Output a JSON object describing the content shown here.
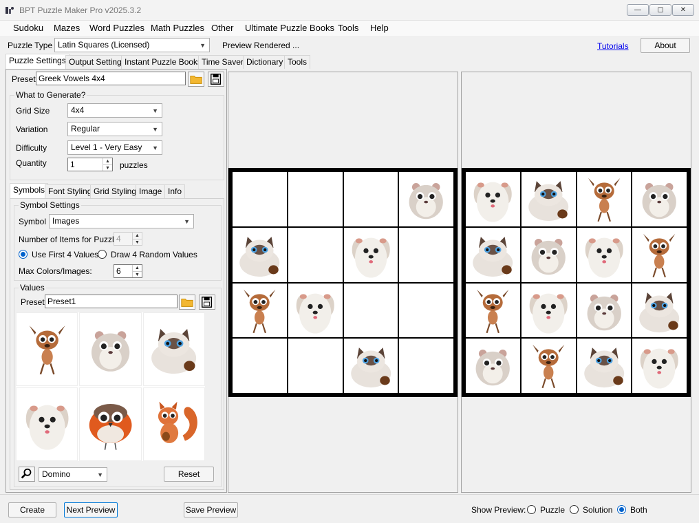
{
  "window": {
    "title": "BPT Puzzle Maker Pro v2025.3.2",
    "minimize": "—",
    "maximize": "▢",
    "close": "✕"
  },
  "menu": [
    "Sudoku",
    "Mazes",
    "Word Puzzles",
    "Math Puzzles",
    "Other",
    "Ultimate Puzzle Books",
    "Tools",
    "Help"
  ],
  "toolbar": {
    "puzzle_type_label": "Puzzle Type",
    "puzzle_type_value": "Latin Squares (Licensed)",
    "status": "Preview Rendered ...",
    "tutorials": "Tutorials",
    "about": "About"
  },
  "main_tabs": [
    "Puzzle Settings",
    "Output Settings",
    "Instant Puzzle Books",
    "Time Saver",
    "Dictionary",
    "Tools"
  ],
  "settings": {
    "preset_label": "Preset",
    "preset_value": "Greek Vowels 4x4",
    "what_to_generate": "What to Generate?",
    "grid_size_label": "Grid Size",
    "grid_size_value": "4x4",
    "variation_label": "Variation",
    "variation_value": "Regular",
    "difficulty_label": "Difficulty",
    "difficulty_value": "Level 1 - Very Easy",
    "quantity_label": "Quantity",
    "quantity_value": "1",
    "quantity_unit": "puzzles"
  },
  "sub_tabs": [
    "Symbols",
    "Font Styling",
    "Grid Styling",
    "Image",
    "Info"
  ],
  "symbols": {
    "group_title": "Symbol Settings",
    "symbol_label": "Symbol",
    "symbol_value": "Images",
    "items_label": "Number of Items for Puzzle:",
    "items_value": "4",
    "radio_first": "Use First 4 Values",
    "radio_random": "Draw 4 Random Values",
    "max_label": "Max Colors/Images:",
    "max_value": "6",
    "values_title": "Values",
    "values_preset_label": "Preset",
    "values_preset_value": "Preset1",
    "images": [
      "deer",
      "hamster",
      "cat",
      "dog",
      "bird",
      "squirrel"
    ],
    "domino_value": "Domino",
    "reset": "Reset"
  },
  "puzzle_grid": [
    [
      "",
      "",
      "",
      "hamster"
    ],
    [
      "cat",
      "",
      "dog",
      ""
    ],
    [
      "deer",
      "dog",
      "",
      ""
    ],
    [
      "",
      "",
      "cat",
      ""
    ]
  ],
  "solution_grid": [
    [
      "dog",
      "cat",
      "deer",
      "hamster"
    ],
    [
      "cat",
      "hamster",
      "dog",
      "deer"
    ],
    [
      "deer",
      "dog",
      "hamster",
      "cat"
    ],
    [
      "hamster",
      "deer",
      "cat",
      "dog"
    ]
  ],
  "bottom": {
    "create": "Create",
    "next_preview": "Next Preview",
    "save_preview": "Save Preview",
    "show_preview": "Show Preview:",
    "opt_puzzle": "Puzzle",
    "opt_solution": "Solution",
    "opt_both": "Both"
  }
}
